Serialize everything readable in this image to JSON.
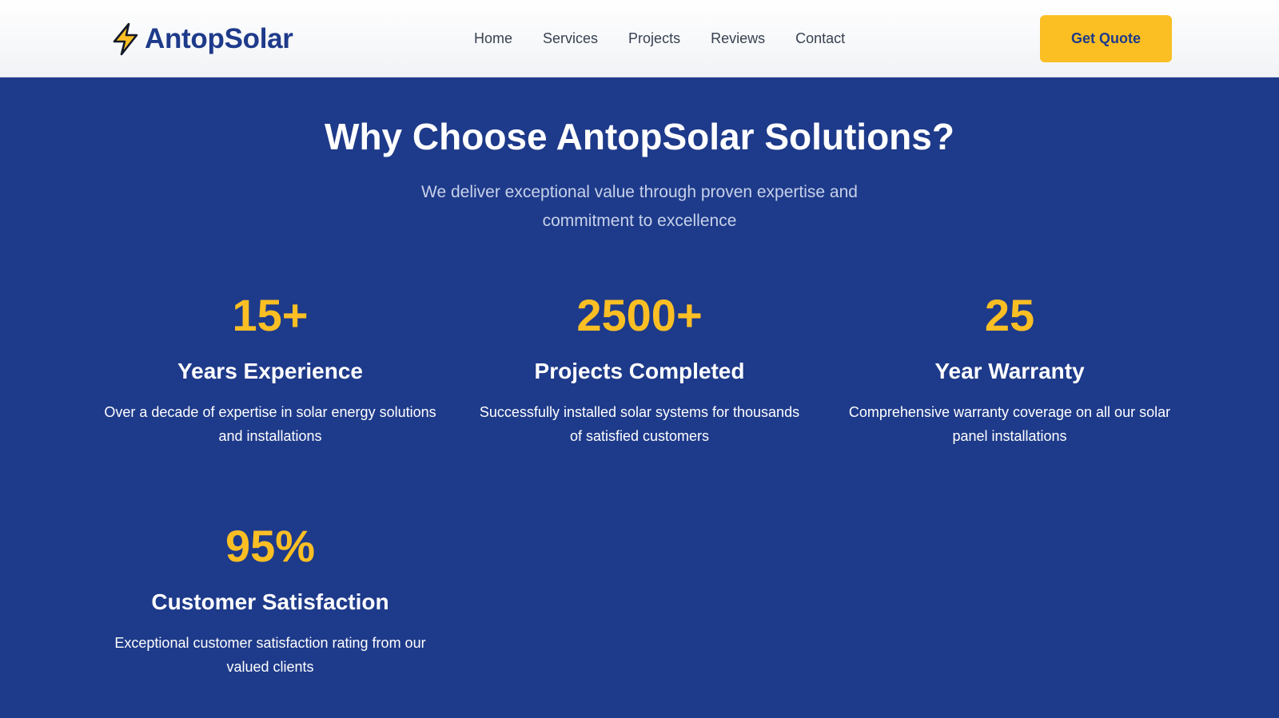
{
  "brand": {
    "name": "AntopSolar",
    "icon": "lightning-bolt-icon",
    "colors": {
      "primary": "#1e3a8a",
      "accent": "#fbbf24"
    }
  },
  "nav": {
    "items": [
      {
        "label": "Home"
      },
      {
        "label": "Services"
      },
      {
        "label": "Projects"
      },
      {
        "label": "Reviews"
      },
      {
        "label": "Contact"
      }
    ],
    "cta_label": "Get Quote"
  },
  "section": {
    "title": "Why Choose AntopSolar Solutions?",
    "subtitle": "We deliver exceptional value through proven expertise and commitment to excellence",
    "stats": [
      {
        "value": "15+",
        "label": "Years Experience",
        "description": "Over a decade of expertise in solar energy solutions and installations"
      },
      {
        "value": "2500+",
        "label": "Projects Completed",
        "description": "Successfully installed solar systems for thousands of satisfied customers"
      },
      {
        "value": "25",
        "label": "Year Warranty",
        "description": "Comprehensive warranty coverage on all our solar panel installations"
      },
      {
        "value": "95%",
        "label": "Customer Satisfaction",
        "description": "Exceptional customer satisfaction rating from our valued clients"
      }
    ]
  }
}
